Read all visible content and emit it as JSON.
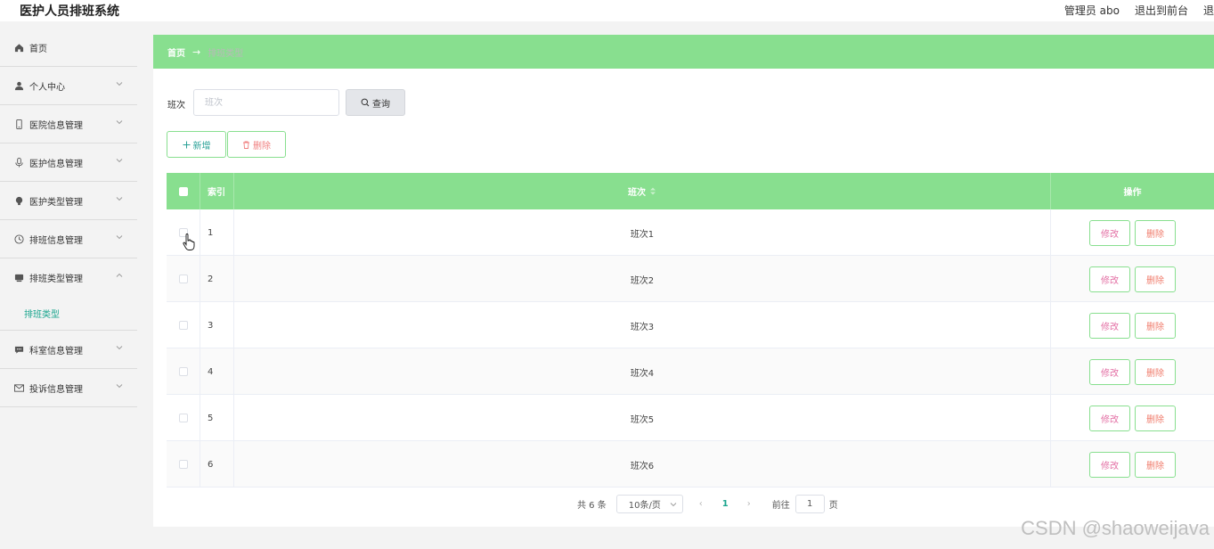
{
  "header": {
    "app_title": "医护人员排班系统",
    "links": [
      "管理员 abo",
      "退出到前台",
      "退"
    ]
  },
  "sidebar": {
    "items": [
      {
        "label": "首页",
        "icon": "home-icon",
        "has_chevron": false
      },
      {
        "label": "个人中心",
        "icon": "user-icon",
        "has_chevron": true
      },
      {
        "label": "医院信息管理",
        "icon": "phone-icon",
        "has_chevron": true
      },
      {
        "label": "医护信息管理",
        "icon": "microphone-icon",
        "has_chevron": true
      },
      {
        "label": "医护类型管理",
        "icon": "lightbulb-icon",
        "has_chevron": true
      },
      {
        "label": "排班信息管理",
        "icon": "clock-icon",
        "has_chevron": true
      },
      {
        "label": "排班类型管理",
        "icon": "monitor-icon",
        "has_chevron": true,
        "expanded": true
      },
      {
        "label": "科室信息管理",
        "icon": "chat-icon",
        "has_chevron": true
      },
      {
        "label": "投诉信息管理",
        "icon": "mail-icon",
        "has_chevron": true
      }
    ],
    "submenu": {
      "label": "排班类型"
    }
  },
  "breadcrumb": {
    "home": "首页",
    "arrow": "→",
    "current": "排班类型"
  },
  "search": {
    "label": "班次",
    "placeholder": "班次",
    "button": "查询"
  },
  "actions": {
    "add": "新增",
    "delete": "删除"
  },
  "table": {
    "headers": {
      "index": "索引",
      "name": "班次",
      "operation": "操作"
    },
    "rows": [
      {
        "index": "1",
        "name": "班次1"
      },
      {
        "index": "2",
        "name": "班次2"
      },
      {
        "index": "3",
        "name": "班次3"
      },
      {
        "index": "4",
        "name": "班次4"
      },
      {
        "index": "5",
        "name": "班次5"
      },
      {
        "index": "6",
        "name": "班次6"
      }
    ],
    "row_actions": {
      "edit": "修改",
      "delete": "删除"
    }
  },
  "pagination": {
    "total": "共 6 条",
    "page_size": "10条/页",
    "prev": "‹",
    "current": "1",
    "next": "›",
    "goto_label": "前往",
    "goto_value": "1",
    "page_suffix": "页"
  },
  "watermark": "CSDN @shaoweijava",
  "colors": {
    "accent": "#88df8f",
    "link_active": "#1aa58e",
    "edit": "#e36fa4",
    "delete": "#f07c6c"
  }
}
